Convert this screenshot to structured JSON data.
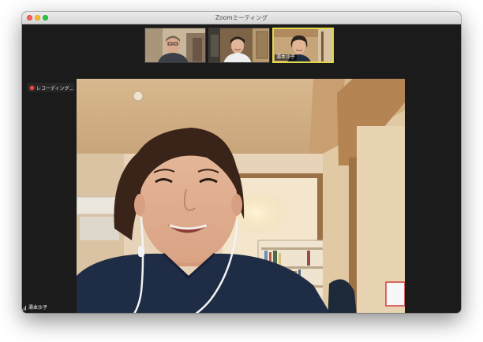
{
  "window": {
    "title": "Zoomミーティング"
  },
  "recording": {
    "label": "レコーディング..."
  },
  "thumbnails": [
    {
      "name": ""
    },
    {
      "name": ""
    },
    {
      "name": "湯本沙子"
    }
  ],
  "active_speaker": {
    "name": "湯本沙子"
  },
  "colors": {
    "active_border": "#e2d84a",
    "record_dot": "#e84a4a",
    "window_bg": "#1b1b1b"
  },
  "icons": [
    "close-button",
    "minimize-button",
    "maximize-button",
    "record-icon",
    "signal-bars-icon"
  ]
}
